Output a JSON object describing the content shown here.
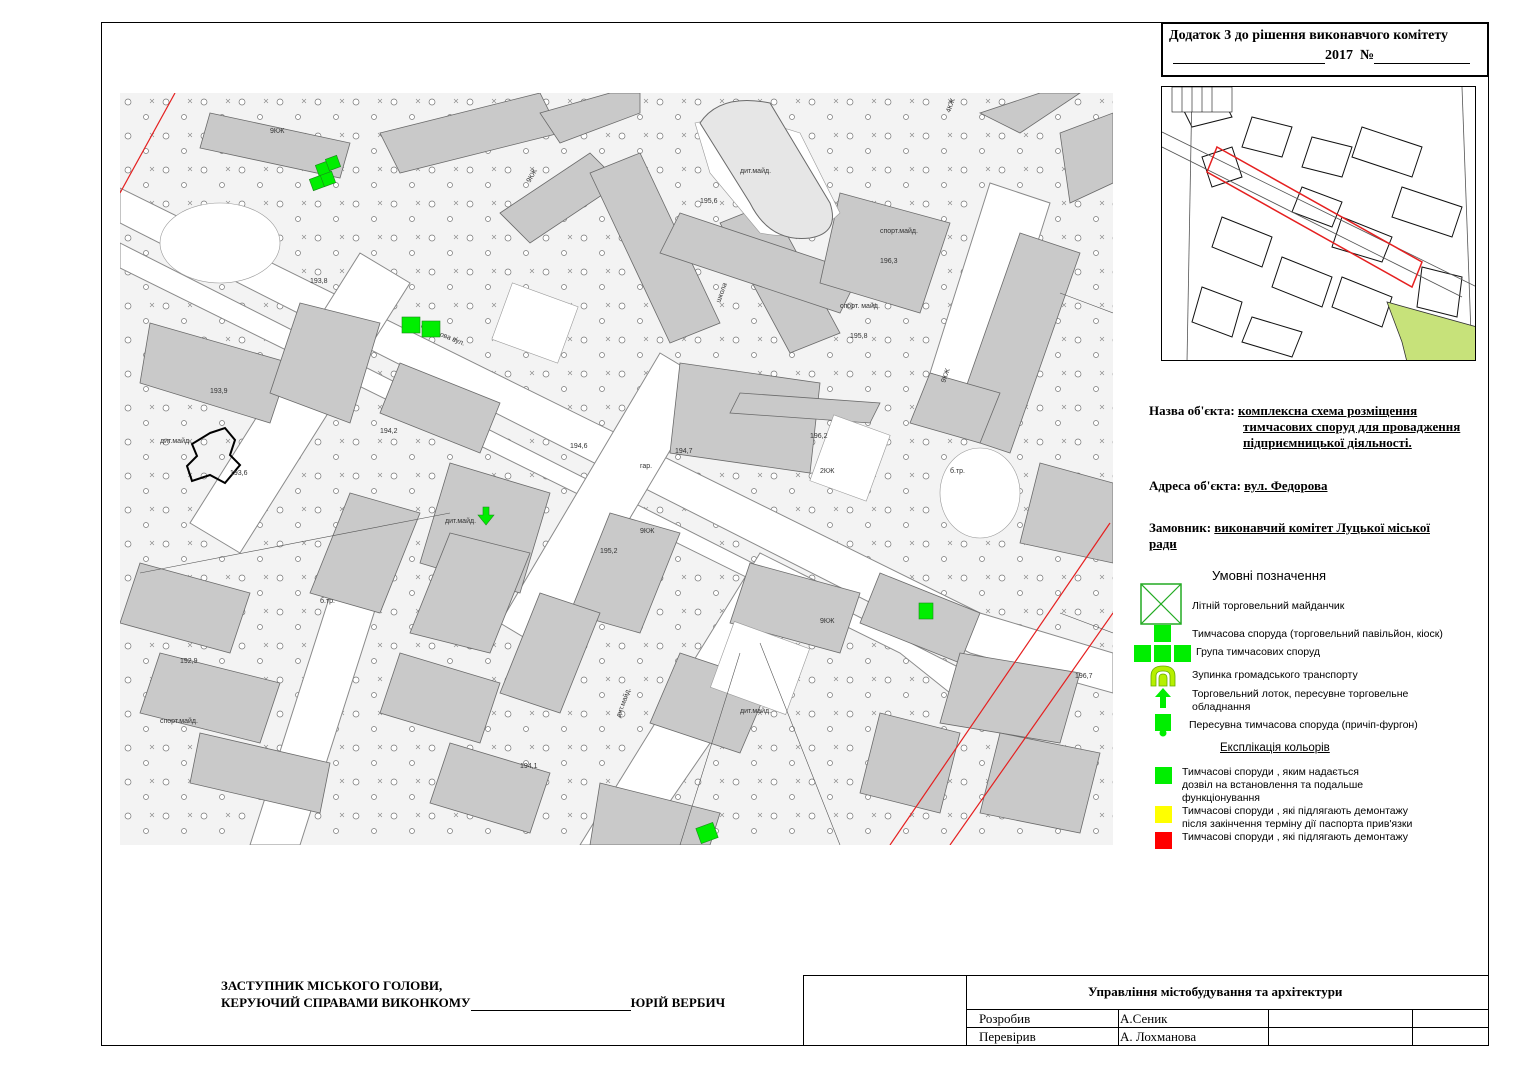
{
  "annex": {
    "line1": "Додаток 3 до рішення виконавчого комітету",
    "year": "2017",
    "number_sign": "№"
  },
  "object": {
    "name_label": "Назва об'єкта:",
    "name_value_1": "комплексна схема розміщення",
    "name_value_2": "тимчасових споруд для провадження",
    "name_value_3": "підприємницької діяльності.",
    "address_label": "Адреса об'єкта:",
    "address_value": "вул. Федорова",
    "client_label": "Замовник:",
    "client_value_1": "виконавчий комітет Луцької міської",
    "client_value_2": "ради"
  },
  "legend": {
    "title": "Умовні позначення",
    "items": [
      {
        "label": "Літній торговельний майданчик",
        "icon": "summer-terrace-icon"
      },
      {
        "label": "Тимчасова споруда (торговельний павільйон, кіоск)",
        "icon": "kiosk-icon"
      },
      {
        "label": "Група тимчасових споруд",
        "icon": "kiosk-group-icon"
      },
      {
        "label": "Зупинка громадського транспорту",
        "icon": "bus-stop-icon"
      },
      {
        "label": "Торговельний лоток, пересувне торговельне обладнання",
        "icon": "stall-arrow-icon"
      },
      {
        "label": "Пересувна тимчасова споруда (причіп-фургон)",
        "icon": "trailer-icon"
      }
    ],
    "color_title": "Експлікація кольорів",
    "colors": [
      {
        "label": "Тимчасові споруди , яким надається дозвіл на встановлення та подальше функціонування",
        "color": "#00ee00"
      },
      {
        "label": "Тимчасові споруди , які підлягають демонтажу після закінчення терміну дії паспорта прив'язки",
        "color": "#ffff00"
      },
      {
        "label": "Тимчасові споруди , які підлягають демонтажу",
        "color": "#ff0000"
      }
    ]
  },
  "map": {
    "street_label": "Федорова вул.",
    "labels": [
      "9КЖ",
      "5КЖ",
      "2КЖ",
      "4КЖ",
      "фем",
      "дит.майд.",
      "спорт.майд.",
      "спорт. майд.",
      "школа",
      "М",
      "А",
      "гар.",
      "б.тр.",
      "тр.",
      "193,8",
      "194,2",
      "195,6",
      "196,2",
      "194,7",
      "195,2",
      "193,9",
      "192,9",
      "194,1",
      "193,6",
      "196,3",
      "195,8",
      "194,6",
      "196,7"
    ]
  },
  "signature": {
    "line1": "ЗАСТУПНИК МІСЬКОГО ГОЛОВИ,",
    "line2": "КЕРУЮЧИЙ СПРАВАМИ ВИКОНКОМУ",
    "name": "ЮРІЙ ВЕРБИЧ"
  },
  "stamp": {
    "org": "Управління містобудування та архітектури",
    "developed_label": "Розробив",
    "developed_name": "А.Сеник",
    "checked_label": "Перевірив",
    "checked_name": "А. Лохманова"
  }
}
